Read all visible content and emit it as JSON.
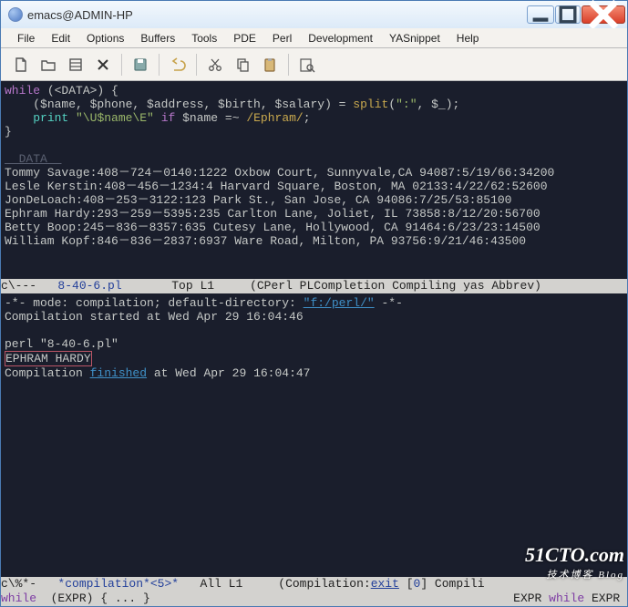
{
  "window": {
    "title": "emacs@ADMIN-HP"
  },
  "menu": [
    "File",
    "Edit",
    "Options",
    "Buffers",
    "Tools",
    "PDE",
    "Perl",
    "Development",
    "YASnippet",
    "Help"
  ],
  "code": {
    "l1a": "while",
    "l1b": " (<DATA>) {",
    "l2a": "    (",
    "l2vars": "$name, $phone, $address, $birth, $salary",
    "l2b": ") = ",
    "l2fn": "split",
    "l2c": "(",
    "l2str": "\":\"",
    "l2d": ", $_);",
    "l3a": "    ",
    "l3p": "print",
    "l3b": " ",
    "l3str": "\"\\U$name\\E\"",
    "l3c": " ",
    "l3if": "if",
    "l3d": " $name =~ ",
    "l3rx": "/Ephram/",
    "l3e": ";",
    "l4": "}",
    "blank": "",
    "dlabel": "__DATA__",
    "d1": "Tommy Savage:408－724－0140:1222 Oxbow Court, Sunnyvale,CA 94087:5/19/66:34200",
    "d2": "Lesle Kerstin:408－456－1234:4 Harvard Square, Boston, MA 02133:4/22/62:52600",
    "d3": "JonDeLoach:408－253－3122:123 Park St., San Jose, CA 94086:7/25/53:85100",
    "d4": "Ephram Hardy:293－259－5395:235 Carlton Lane, Joliet, IL 73858:8/12/20:56700",
    "d5": "Betty Boop:245－836－8357:635 Cutesy Lane, Hollywood, CA 91464:6/23/23:14500",
    "d6": "William Kopf:846－836－2837:6937 Ware Road, Milton, PA 93756:9/21/46:43500"
  },
  "modeline1": {
    "pre": "c\\---   ",
    "file": "8-40-6.pl",
    "mid": "       Top L1     ",
    "modes": "(CPerl PLCompletion Compiling yas Abbrev)"
  },
  "compilation": {
    "l1a": "‑*- mode: compilation; default-directory: ",
    "l1b": "\"f:/perl/\"",
    "l1c": " -*-",
    "l2": "Compilation started at Wed Apr 29 16:04:46",
    "blank": "",
    "l3": "perl \"8-40-6.pl\"",
    "l4": "EPHRAM HARDY",
    "l5a": "Compilation ",
    "l5b": "finished",
    "l5c": " at Wed Apr 29 16:04:47"
  },
  "modeline2": {
    "pre": "c\\%*-   ",
    "file": "*compilation*<5>*",
    "mid": "   All L1     (Compilation:",
    "exit": "exit",
    "sp": " [",
    "num": "0",
    "post": "] Compili"
  },
  "minibuf": {
    "left_a": "while",
    "left_b": "  (EXPR) { ... }",
    "right_a": "EXPR ",
    "right_b": "while",
    " right_c": " EXPR"
  },
  "watermark": {
    "main": "51CTO.com",
    "sub": "技术博客   Blog"
  }
}
